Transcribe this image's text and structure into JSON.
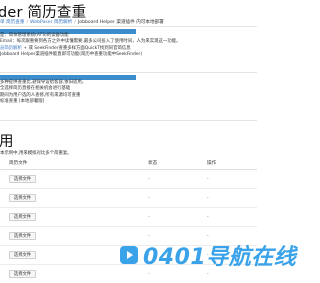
{
  "header": {
    "title": "der 简历查重",
    "breadcrumb": [
      {
        "label": "单 简历查重"
      },
      {
        "label": "WebPaser 简历解析"
      },
      {
        "label": "Jobboard Helper 渠道插件 内可本地部署"
      }
    ]
  },
  "intro": {
    "line1_label": "是",
    "line1_text": "：简体管理系统(ATS)的读备功能",
    "line2_label": "Email",
    "line2_text": "：每次跟重要到各方之外中读懂需要,最多公司投入了使用时间，人为来实现这一功能。",
    "line3_link": "员简历解析",
    "line3_text": " + 或 SeekFinder查重多样方面QuickT找到同官简信息",
    "line4_text": "Jobboard Helper渠道插件能直即可功能(简历中查重功能中SeekFinder)"
  },
  "features": {
    "items": [
      "多种提供查重比,避保导设给客容,依旧适用。",
      "全选择简历直接在相关机会进行基础",
      "期间为用户选的人查修,所有来源均可查重",
      "标准查重 [本地部署版]"
    ]
  },
  "usage": {
    "title": "用",
    "description": "本示例中,用来模拟对比多个简重复。",
    "table": {
      "headers": [
        "简历文件",
        "状态",
        "操作"
      ],
      "rows": [
        {
          "button": "选择文件",
          "status": "-",
          "action": "-"
        },
        {
          "button": "选择文件",
          "status": "-",
          "action": "-"
        },
        {
          "button": "选择文件",
          "status": "-",
          "action": "-"
        },
        {
          "button": "选择文件",
          "status": "-",
          "action": "-"
        },
        {
          "button": "选择文件",
          "status": "-",
          "action": "-"
        },
        {
          "button": "选择文件",
          "status": "-",
          "action": "-"
        }
      ]
    }
  },
  "watermark": {
    "text": "0401导航在线",
    "icon": "play-logo-icon",
    "color": "#2b9be8"
  },
  "colors": {
    "link": "#3b78c4",
    "accent_bar": "#3c8dcc",
    "border": "#dfdfdf"
  }
}
